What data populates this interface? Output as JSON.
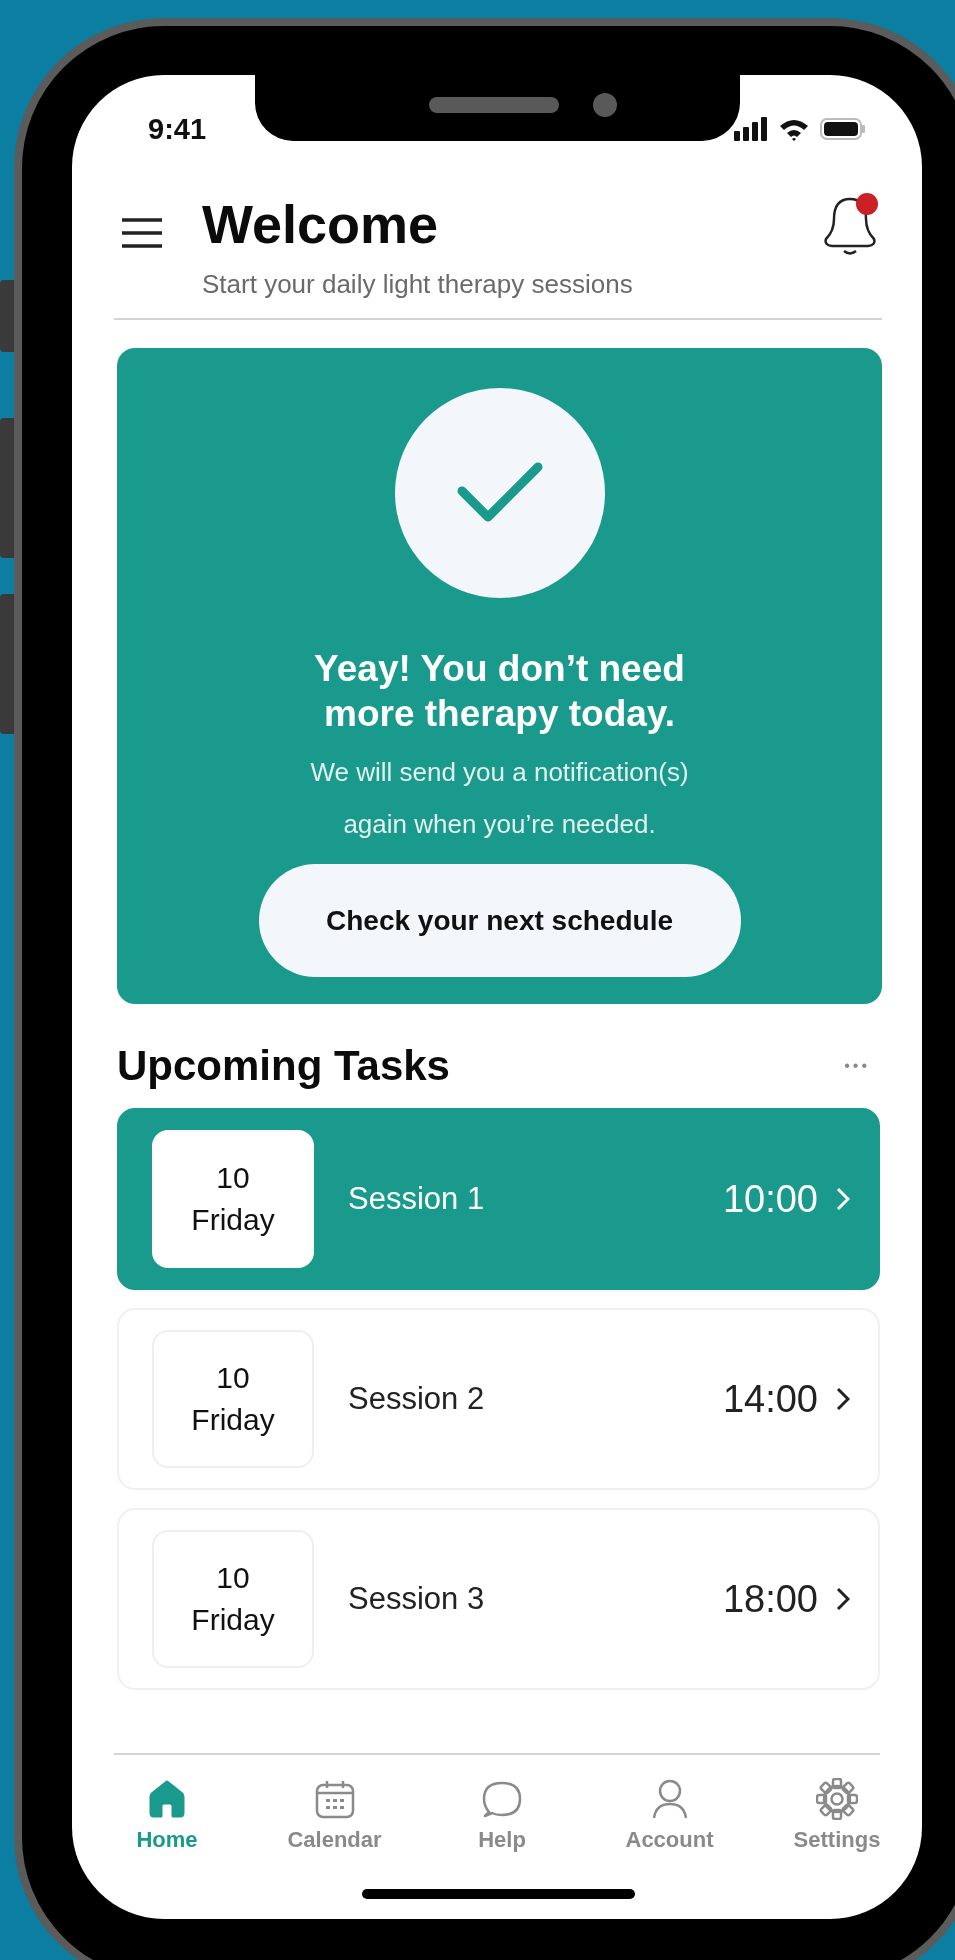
{
  "status_bar": {
    "time": "9:41"
  },
  "header": {
    "title": "Welcome",
    "subtitle": "Start your daily light therapy sessions",
    "notifications_unread": true
  },
  "hero_card": {
    "title": "Yeay! You don’t need more therapy today.",
    "message": "We will send you a notification(s) again when you’re needed.",
    "button": "Check your next schedule"
  },
  "upcoming": {
    "title": "Upcoming Tasks",
    "more": "•••",
    "tasks": [
      {
        "day": "10",
        "weekday": "Friday",
        "name": "Session 1",
        "time": "10:00",
        "selected": true
      },
      {
        "day": "10",
        "weekday": "Friday",
        "name": "Session 2",
        "time": "14:00",
        "selected": false
      },
      {
        "day": "10",
        "weekday": "Friday",
        "name": "Session 3",
        "time": "18:00",
        "selected": false
      }
    ]
  },
  "nav": [
    {
      "label": "Home",
      "kind": "home",
      "selected": true
    },
    {
      "label": "Calendar",
      "kind": "calendar",
      "selected": false
    },
    {
      "label": "Help",
      "kind": "chat",
      "selected": false
    },
    {
      "label": "Account",
      "kind": "person",
      "selected": false
    },
    {
      "label": "Settings",
      "kind": "gear",
      "selected": false
    }
  ]
}
